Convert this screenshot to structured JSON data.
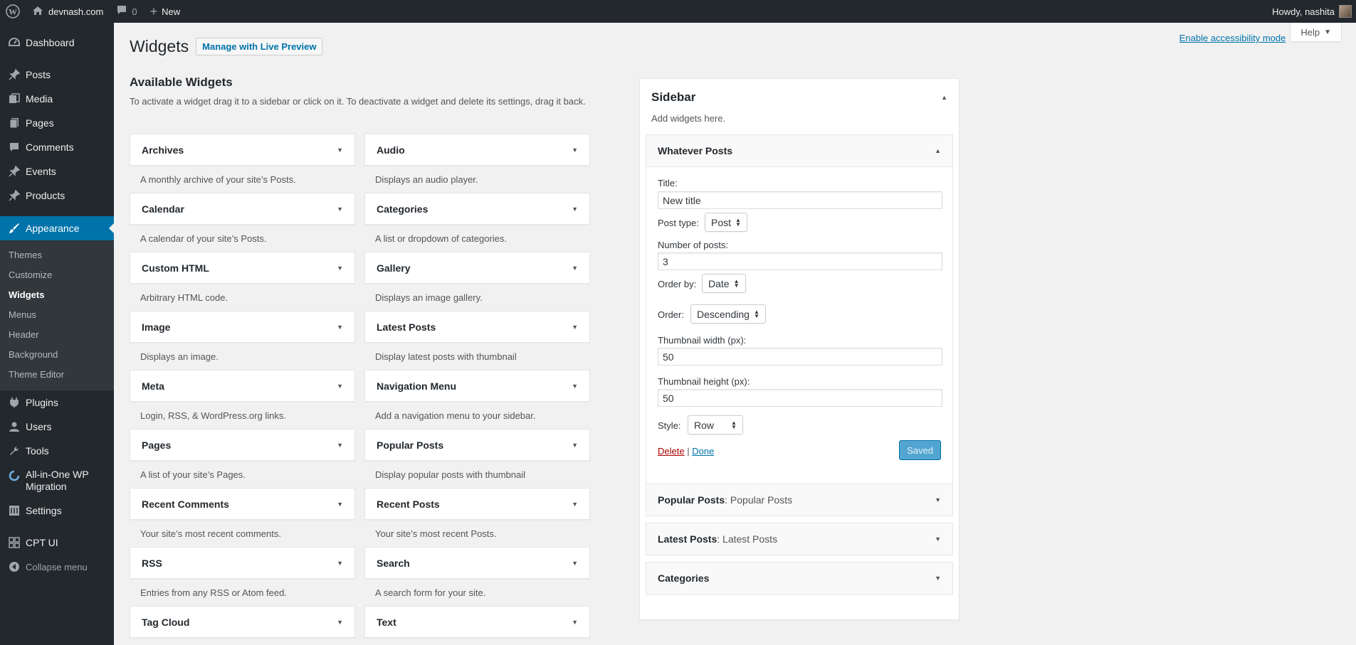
{
  "adminbar": {
    "site": "devnash.com",
    "comments_count": "0",
    "new_label": "New",
    "howdy": "Howdy, nashita"
  },
  "menu": {
    "dashboard": "Dashboard",
    "posts": "Posts",
    "media": "Media",
    "pages": "Pages",
    "comments": "Comments",
    "events": "Events",
    "products": "Products",
    "appearance": "Appearance",
    "sub": [
      "Themes",
      "Customize",
      "Widgets",
      "Menus",
      "Header",
      "Background",
      "Theme Editor"
    ],
    "plugins": "Plugins",
    "users": "Users",
    "tools": "Tools",
    "aiowm_line1": "All-in-One WP",
    "aiowm_line2": "Migration",
    "settings": "Settings",
    "cptui": "CPT UI",
    "collapse": "Collapse menu"
  },
  "header": {
    "title": "Widgets",
    "live_preview": "Manage with Live Preview",
    "accessibility": "Enable accessibility mode",
    "help": "Help"
  },
  "available": {
    "title": "Available Widgets",
    "desc": "To activate a widget drag it to a sidebar or click on it. To deactivate a widget and delete its settings, drag it back.",
    "widgets": [
      {
        "name": "Archives",
        "desc": "A monthly archive of your site’s Posts."
      },
      {
        "name": "Audio",
        "desc": "Displays an audio player."
      },
      {
        "name": "Calendar",
        "desc": "A calendar of your site’s Posts."
      },
      {
        "name": "Categories",
        "desc": "A list or dropdown of categories."
      },
      {
        "name": "Custom HTML",
        "desc": "Arbitrary HTML code."
      },
      {
        "name": "Gallery",
        "desc": "Displays an image gallery."
      },
      {
        "name": "Image",
        "desc": "Displays an image."
      },
      {
        "name": "Latest Posts",
        "desc": "Display latest posts with thumbnail"
      },
      {
        "name": "Meta",
        "desc": "Login, RSS, & WordPress.org links."
      },
      {
        "name": "Navigation Menu",
        "desc": "Add a navigation menu to your sidebar."
      },
      {
        "name": "Pages",
        "desc": "A list of your site’s Pages."
      },
      {
        "name": "Popular Posts",
        "desc": "Display popular posts with thumbnail"
      },
      {
        "name": "Recent Comments",
        "desc": "Your site’s most recent comments."
      },
      {
        "name": "Recent Posts",
        "desc": "Your site’s most recent Posts."
      },
      {
        "name": "RSS",
        "desc": "Entries from any RSS or Atom feed."
      },
      {
        "name": "Search",
        "desc": "A search form for your site."
      },
      {
        "name": "Tag Cloud",
        "desc": ""
      },
      {
        "name": "Text",
        "desc": ""
      }
    ]
  },
  "sidebar": {
    "title": "Sidebar",
    "subtitle": "Add widgets here.",
    "open_widget": {
      "name": "Whatever Posts",
      "title_label": "Title:",
      "title_value": "New title",
      "post_type_label": "Post type:",
      "post_type_value": "Post",
      "num_label": "Number of posts:",
      "num_value": "3",
      "orderby_label": "Order by:",
      "orderby_value": "Date",
      "order_label": "Order:",
      "order_value": "Descending",
      "thumb_w_label": "Thumbnail width (px):",
      "thumb_w_value": "50",
      "thumb_h_label": "Thumbnail height (px):",
      "thumb_h_value": "50",
      "style_label": "Style:",
      "style_value": "Row",
      "delete": "Delete",
      "sep": "|",
      "done": "Done",
      "saved": "Saved"
    },
    "collapsed": [
      {
        "name": "Popular Posts",
        "instance": ": Popular Posts"
      },
      {
        "name": "Latest Posts",
        "instance": ": Latest Posts"
      },
      {
        "name": "Categories",
        "instance": ""
      }
    ]
  },
  "colors": {
    "adminbar_bg": "#23282d",
    "accent": "#0073aa",
    "page_bg": "#f1f1f1"
  }
}
